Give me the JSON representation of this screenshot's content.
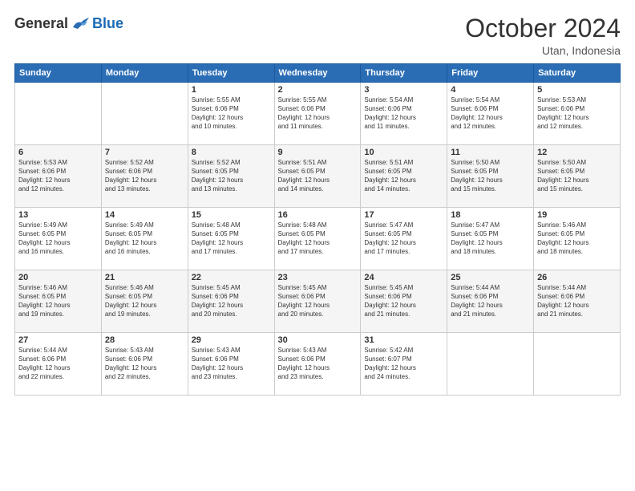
{
  "header": {
    "logo_general": "General",
    "logo_blue": "Blue",
    "month_title": "October 2024",
    "subtitle": "Utan, Indonesia"
  },
  "days_of_week": [
    "Sunday",
    "Monday",
    "Tuesday",
    "Wednesday",
    "Thursday",
    "Friday",
    "Saturday"
  ],
  "weeks": [
    [
      {
        "day": "",
        "detail": ""
      },
      {
        "day": "",
        "detail": ""
      },
      {
        "day": "1",
        "detail": "Sunrise: 5:55 AM\nSunset: 6:06 PM\nDaylight: 12 hours\nand 10 minutes."
      },
      {
        "day": "2",
        "detail": "Sunrise: 5:55 AM\nSunset: 6:06 PM\nDaylight: 12 hours\nand 11 minutes."
      },
      {
        "day": "3",
        "detail": "Sunrise: 5:54 AM\nSunset: 6:06 PM\nDaylight: 12 hours\nand 11 minutes."
      },
      {
        "day": "4",
        "detail": "Sunrise: 5:54 AM\nSunset: 6:06 PM\nDaylight: 12 hours\nand 12 minutes."
      },
      {
        "day": "5",
        "detail": "Sunrise: 5:53 AM\nSunset: 6:06 PM\nDaylight: 12 hours\nand 12 minutes."
      }
    ],
    [
      {
        "day": "6",
        "detail": "Sunrise: 5:53 AM\nSunset: 6:06 PM\nDaylight: 12 hours\nand 12 minutes."
      },
      {
        "day": "7",
        "detail": "Sunrise: 5:52 AM\nSunset: 6:06 PM\nDaylight: 12 hours\nand 13 minutes."
      },
      {
        "day": "8",
        "detail": "Sunrise: 5:52 AM\nSunset: 6:05 PM\nDaylight: 12 hours\nand 13 minutes."
      },
      {
        "day": "9",
        "detail": "Sunrise: 5:51 AM\nSunset: 6:05 PM\nDaylight: 12 hours\nand 14 minutes."
      },
      {
        "day": "10",
        "detail": "Sunrise: 5:51 AM\nSunset: 6:05 PM\nDaylight: 12 hours\nand 14 minutes."
      },
      {
        "day": "11",
        "detail": "Sunrise: 5:50 AM\nSunset: 6:05 PM\nDaylight: 12 hours\nand 15 minutes."
      },
      {
        "day": "12",
        "detail": "Sunrise: 5:50 AM\nSunset: 6:05 PM\nDaylight: 12 hours\nand 15 minutes."
      }
    ],
    [
      {
        "day": "13",
        "detail": "Sunrise: 5:49 AM\nSunset: 6:05 PM\nDaylight: 12 hours\nand 16 minutes."
      },
      {
        "day": "14",
        "detail": "Sunrise: 5:49 AM\nSunset: 6:05 PM\nDaylight: 12 hours\nand 16 minutes."
      },
      {
        "day": "15",
        "detail": "Sunrise: 5:48 AM\nSunset: 6:05 PM\nDaylight: 12 hours\nand 17 minutes."
      },
      {
        "day": "16",
        "detail": "Sunrise: 5:48 AM\nSunset: 6:05 PM\nDaylight: 12 hours\nand 17 minutes."
      },
      {
        "day": "17",
        "detail": "Sunrise: 5:47 AM\nSunset: 6:05 PM\nDaylight: 12 hours\nand 17 minutes."
      },
      {
        "day": "18",
        "detail": "Sunrise: 5:47 AM\nSunset: 6:05 PM\nDaylight: 12 hours\nand 18 minutes."
      },
      {
        "day": "19",
        "detail": "Sunrise: 5:46 AM\nSunset: 6:05 PM\nDaylight: 12 hours\nand 18 minutes."
      }
    ],
    [
      {
        "day": "20",
        "detail": "Sunrise: 5:46 AM\nSunset: 6:05 PM\nDaylight: 12 hours\nand 19 minutes."
      },
      {
        "day": "21",
        "detail": "Sunrise: 5:46 AM\nSunset: 6:05 PM\nDaylight: 12 hours\nand 19 minutes."
      },
      {
        "day": "22",
        "detail": "Sunrise: 5:45 AM\nSunset: 6:06 PM\nDaylight: 12 hours\nand 20 minutes."
      },
      {
        "day": "23",
        "detail": "Sunrise: 5:45 AM\nSunset: 6:06 PM\nDaylight: 12 hours\nand 20 minutes."
      },
      {
        "day": "24",
        "detail": "Sunrise: 5:45 AM\nSunset: 6:06 PM\nDaylight: 12 hours\nand 21 minutes."
      },
      {
        "day": "25",
        "detail": "Sunrise: 5:44 AM\nSunset: 6:06 PM\nDaylight: 12 hours\nand 21 minutes."
      },
      {
        "day": "26",
        "detail": "Sunrise: 5:44 AM\nSunset: 6:06 PM\nDaylight: 12 hours\nand 21 minutes."
      }
    ],
    [
      {
        "day": "27",
        "detail": "Sunrise: 5:44 AM\nSunset: 6:06 PM\nDaylight: 12 hours\nand 22 minutes."
      },
      {
        "day": "28",
        "detail": "Sunrise: 5:43 AM\nSunset: 6:06 PM\nDaylight: 12 hours\nand 22 minutes."
      },
      {
        "day": "29",
        "detail": "Sunrise: 5:43 AM\nSunset: 6:06 PM\nDaylight: 12 hours\nand 23 minutes."
      },
      {
        "day": "30",
        "detail": "Sunrise: 5:43 AM\nSunset: 6:06 PM\nDaylight: 12 hours\nand 23 minutes."
      },
      {
        "day": "31",
        "detail": "Sunrise: 5:42 AM\nSunset: 6:07 PM\nDaylight: 12 hours\nand 24 minutes."
      },
      {
        "day": "",
        "detail": ""
      },
      {
        "day": "",
        "detail": ""
      }
    ]
  ]
}
